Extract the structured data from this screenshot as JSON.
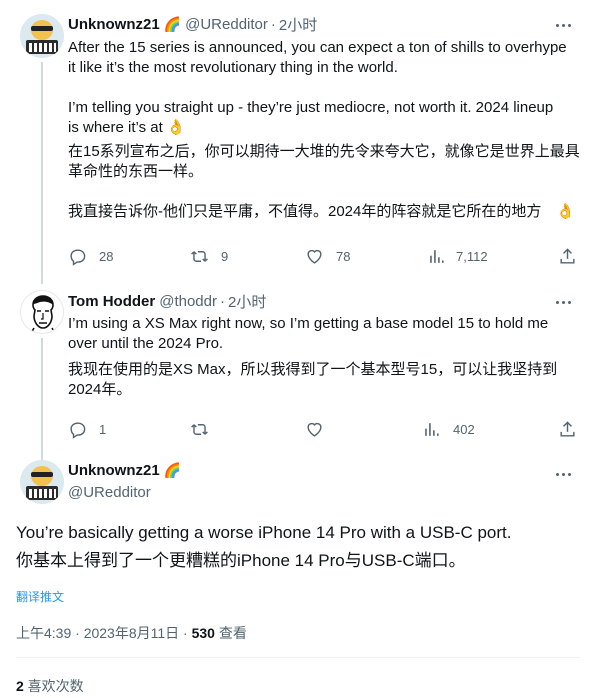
{
  "tweets": [
    {
      "name": "Unknownz21",
      "badge": "🌈",
      "handle": "@URedditor",
      "time": "2小时",
      "lines": [
        "After the 15 series is announced, you can expect a ton of shills to overhype",
        "it like it’s the most revolutionary thing in the world.",
        "",
        "I’m telling you straight up - they’re just mediocre, not worth it. 2024 lineup",
        "is where it’s at 👌",
        "在15系列宣布之后，你可以期待一大堆的先令来夸大它，就像它是世界上最具",
        "革命性的东西一样。",
        "",
        "我直接告诉你-他们只是平庸，不值得。2024年的阵容就是它所在的地方"
      ],
      "trailing_emoji": "👌",
      "stats": {
        "replies": "28",
        "retweets": "9",
        "likes": "78",
        "views": "7,112"
      }
    },
    {
      "name": "Tom Hodder",
      "handle": "@thoddr",
      "time": "2小时",
      "lines": [
        "I’m using a XS Max right now, so I’m getting a base model 15 to hold me",
        "over until the 2024 Pro.",
        "我现在使用的是XS Max，所以我得到了一个基本型号15，可以让我坚持到",
        "2024年。"
      ],
      "stats": {
        "replies": "1",
        "retweets": "",
        "likes": "",
        "views": "402"
      }
    }
  ],
  "main_tweet": {
    "name": "Unknownz21",
    "badge": "🌈",
    "handle": "@URedditor",
    "text_en": "You’re basically getting a worse iPhone 14 Pro with a USB-C port.",
    "text_zh": "你基本上得到了一个更糟糕的iPhone 14 Pro与USB-C端口。",
    "translate_label": "翻译推文",
    "timestamp": "上午4:39 · 2023年8月11日",
    "sep": " · ",
    "views_count": "530",
    "views_label": " 查看",
    "likes_count": "2",
    "likes_label": " 喜欢次数"
  },
  "icons": [
    "reply-icon",
    "retweet-icon",
    "like-icon",
    "views-icon",
    "share-icon",
    "more-icon"
  ],
  "colors": {
    "text": "#0f1419",
    "secondary": "#536471",
    "link": "#1d9bf0",
    "divider": "#eff3f4",
    "thread": "#cfd9de"
  }
}
